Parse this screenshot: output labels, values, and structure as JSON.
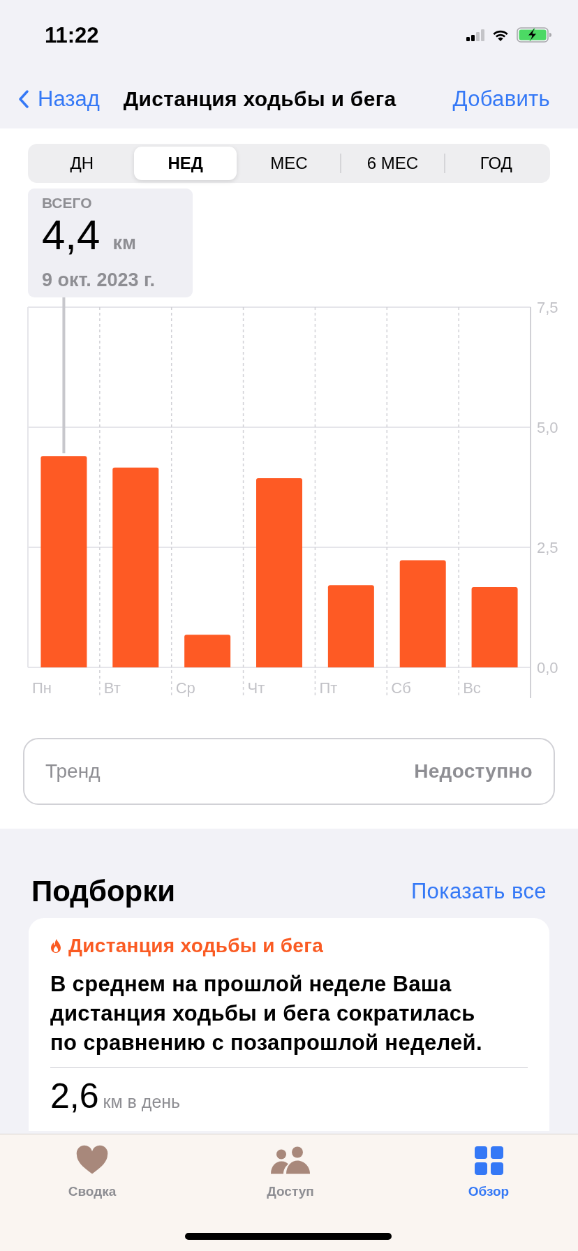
{
  "status_bar": {
    "time": "11:22"
  },
  "nav": {
    "back": "Назад",
    "title": "Дистанция ходьбы и бега",
    "action": "Добавить"
  },
  "segments": [
    {
      "label": "ДН",
      "selected": false
    },
    {
      "label": "НЕД",
      "selected": true
    },
    {
      "label": "МЕС",
      "selected": false
    },
    {
      "label": "6 МЕС",
      "selected": false
    },
    {
      "label": "ГОД",
      "selected": false
    }
  ],
  "summary": {
    "label": "ВСЕГО",
    "value": "4,4",
    "unit": "км",
    "date": "9 окт. 2023 г."
  },
  "chart_data": {
    "type": "bar",
    "categories": [
      "Пн",
      "Вт",
      "Ср",
      "Чт",
      "Пт",
      "Сб",
      "Вс"
    ],
    "series": [
      {
        "color": "#fe5a24",
        "values": [
          4.4,
          4.16,
          0.68,
          3.94,
          1.71,
          2.23,
          1.67
        ]
      }
    ],
    "ylim": [
      0,
      7.5
    ],
    "yticks": [
      {
        "value": 0,
        "label": "0,0"
      },
      {
        "value": 2.5,
        "label": "2,5"
      },
      {
        "value": 5,
        "label": "5,0"
      },
      {
        "value": 7.5,
        "label": "7,5"
      }
    ]
  },
  "trend": {
    "label": "Тренд",
    "value": "Недоступно"
  },
  "highlights": {
    "title": "Подборки",
    "link": "Показать все",
    "cards": [
      {
        "category": "Дистанция ходьбы и бега",
        "text": "В среднем на прошлой неделе Ваша дистанция ходьбы и бега сократилась по сравнению с позапрошлой неделей.",
        "value": "2,6",
        "unit": "км в день"
      }
    ]
  },
  "tab_bar": [
    {
      "label": "Сводка",
      "selected": false
    },
    {
      "label": "Доступ",
      "selected": false
    },
    {
      "label": "Обзор",
      "selected": true
    }
  ]
}
